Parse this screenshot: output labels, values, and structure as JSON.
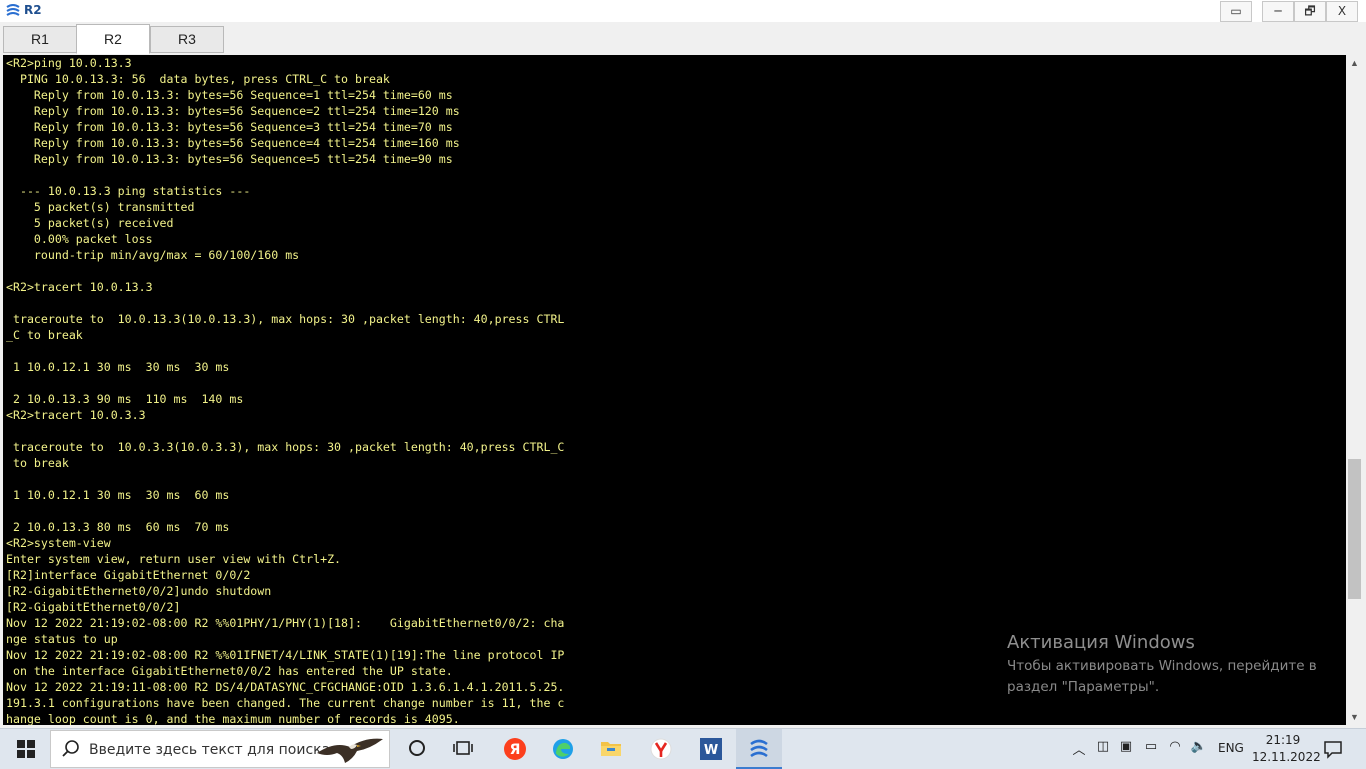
{
  "window": {
    "title": "R2",
    "buttons": {
      "restore_left": "▭",
      "minimize": "─",
      "maximize": "🗗",
      "close": "X"
    }
  },
  "tabs": [
    {
      "label": "R1",
      "active": false
    },
    {
      "label": "R2",
      "active": true
    },
    {
      "label": "R3",
      "active": false
    }
  ],
  "terminal": {
    "text_color": "#f2f28a",
    "background": "#000000",
    "lines": [
      "<R2>ping 10.0.13.3",
      "  PING 10.0.13.3: 56  data bytes, press CTRL_C to break",
      "    Reply from 10.0.13.3: bytes=56 Sequence=1 ttl=254 time=60 ms",
      "    Reply from 10.0.13.3: bytes=56 Sequence=2 ttl=254 time=120 ms",
      "    Reply from 10.0.13.3: bytes=56 Sequence=3 ttl=254 time=70 ms",
      "    Reply from 10.0.13.3: bytes=56 Sequence=4 ttl=254 time=160 ms",
      "    Reply from 10.0.13.3: bytes=56 Sequence=5 ttl=254 time=90 ms",
      "",
      "  --- 10.0.13.3 ping statistics ---",
      "    5 packet(s) transmitted",
      "    5 packet(s) received",
      "    0.00% packet loss",
      "    round-trip min/avg/max = 60/100/160 ms",
      "",
      "<R2>tracert 10.0.13.3",
      "",
      " traceroute to  10.0.13.3(10.0.13.3), max hops: 30 ,packet length: 40,press CTRL",
      "_C to break",
      "",
      " 1 10.0.12.1 30 ms  30 ms  30 ms",
      "",
      " 2 10.0.13.3 90 ms  110 ms  140 ms",
      "<R2>tracert 10.0.3.3",
      "",
      " traceroute to  10.0.3.3(10.0.3.3), max hops: 30 ,packet length: 40,press CTRL_C",
      " to break",
      "",
      " 1 10.0.12.1 30 ms  30 ms  60 ms",
      "",
      " 2 10.0.13.3 80 ms  60 ms  70 ms",
      "<R2>system-view",
      "Enter system view, return user view with Ctrl+Z.",
      "[R2]interface GigabitEthernet 0/0/2",
      "[R2-GigabitEthernet0/0/2]undo shutdown",
      "[R2-GigabitEthernet0/0/2]",
      "Nov 12 2022 21:19:02-08:00 R2 %%01PHY/1/PHY(1)[18]:    GigabitEthernet0/0/2: cha",
      "nge status to up",
      "Nov 12 2022 21:19:02-08:00 R2 %%01IFNET/4/LINK_STATE(1)[19]:The line protocol IP",
      " on the interface GigabitEthernet0/0/2 has entered the UP state.",
      "Nov 12 2022 21:19:11-08:00 R2 DS/4/DATASYNC_CFGCHANGE:OID 1.3.6.1.4.1.2011.5.25.",
      "191.3.1 configurations have been changed. The current change number is 11, the c",
      "hange loop count is 0, and the maximum number of records is 4095."
    ]
  },
  "scrollbar": {
    "position_fraction": 0.78,
    "visible_fraction": 0.22
  },
  "watermark": {
    "title": "Активация Windows",
    "line1": "Чтобы активировать Windows, перейдите в",
    "line2": "раздел \"Параметры\"."
  },
  "taskbar": {
    "search_placeholder": "Введите здесь текст для поиска",
    "apps": [
      "cortana-icon",
      "task-view-icon",
      "yandex-icon",
      "edge-icon",
      "file-explorer-icon",
      "yandex-browser-icon",
      "word-icon",
      "ensp-icon"
    ],
    "language": "ENG",
    "time": "21:19",
    "date": "12.11.2022"
  }
}
